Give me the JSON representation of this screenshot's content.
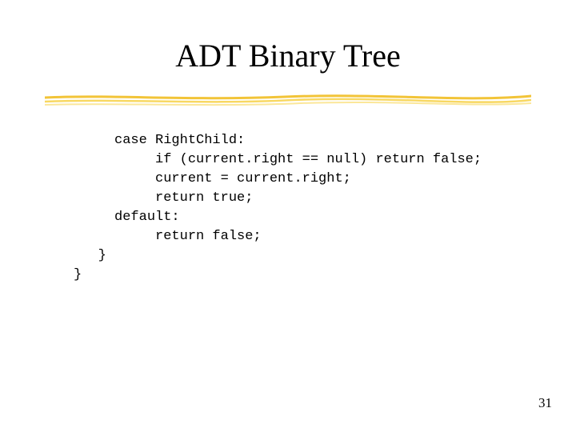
{
  "title": "ADT Binary Tree",
  "code_lines": {
    "l0": "     case RightChild:",
    "l1": "          if (current.right == null) return false;",
    "l2": "          current = current.right;",
    "l3": "          return true;",
    "l4": "     default:",
    "l5": "          return false;",
    "l6": "   }",
    "l7": "}"
  },
  "page_number": "31"
}
